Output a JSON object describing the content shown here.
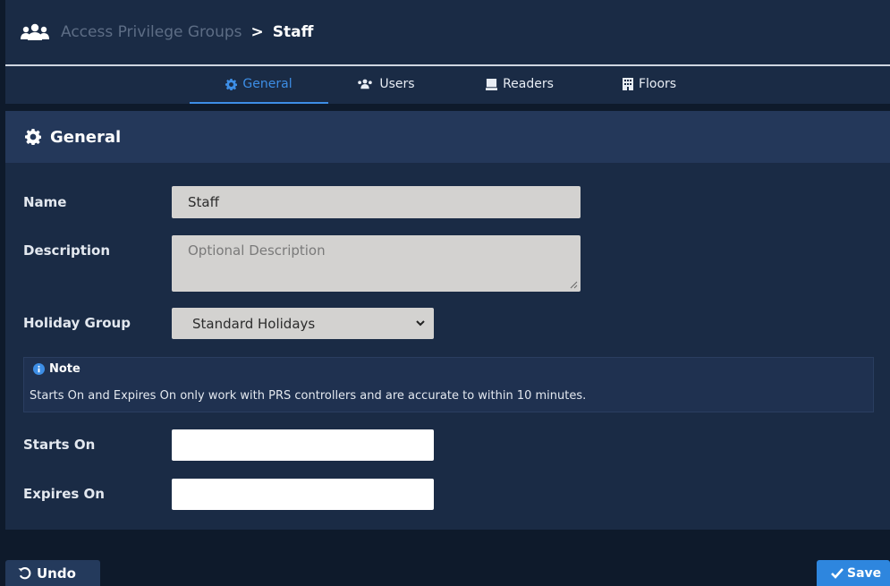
{
  "breadcrumb": {
    "parent": "Access Privilege Groups",
    "separator": ">",
    "current": "Staff"
  },
  "tabs": [
    {
      "label": "General",
      "icon": "gear-icon",
      "active": true
    },
    {
      "label": "Users",
      "icon": "users-icon",
      "active": false
    },
    {
      "label": "Readers",
      "icon": "reader-icon",
      "active": false
    },
    {
      "label": "Floors",
      "icon": "building-icon",
      "active": false
    }
  ],
  "panel": {
    "title": "General",
    "icon": "gear-icon"
  },
  "form": {
    "name_label": "Name",
    "name_value": "Staff",
    "description_label": "Description",
    "description_placeholder": "Optional Description",
    "holiday_label": "Holiday Group",
    "holiday_value": "Standard Holidays",
    "starts_label": "Starts On",
    "starts_value": "",
    "expires_label": "Expires On",
    "expires_value": ""
  },
  "note": {
    "title": "Note",
    "text": "Starts On and Expires On only work with PRS controllers and are accurate to within 10 minutes."
  },
  "actions": {
    "undo_label": "Undo",
    "save_label": "Save"
  },
  "colors": {
    "accent": "#2e86de",
    "header_bg": "#1a2b45",
    "page_bg": "#0e1a2b"
  }
}
